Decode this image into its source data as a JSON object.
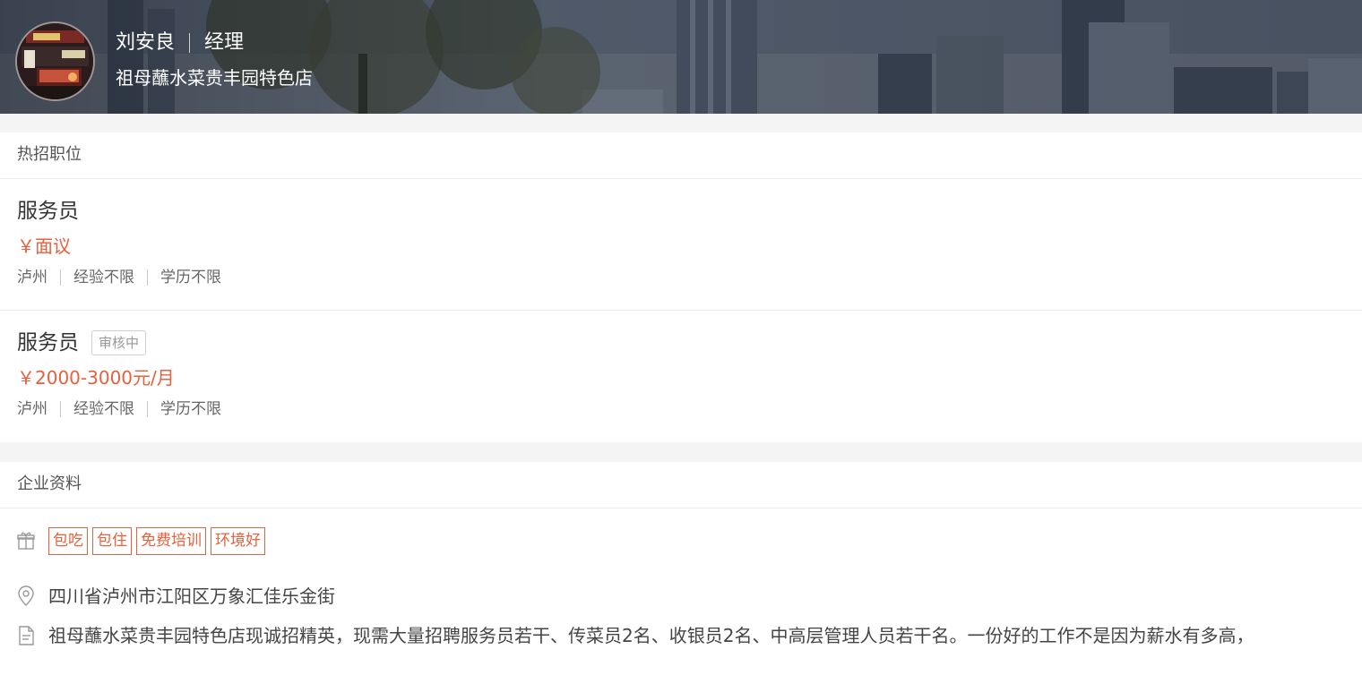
{
  "header": {
    "name": "刘安良",
    "role": "经理",
    "company": "祖母蘸水菜贵丰园特色店",
    "avatar_icon": "restaurant-storefront-photo"
  },
  "jobs_section": {
    "title": "热招职位",
    "jobs": [
      {
        "name": "服务员",
        "badge": "",
        "salary": "￥面议",
        "city": "泸州",
        "experience": "经验不限",
        "education": "学历不限"
      },
      {
        "name": "服务员",
        "badge": "审核中",
        "salary": "￥2000-3000元/月",
        "city": "泸州",
        "experience": "经验不限",
        "education": "学历不限"
      }
    ]
  },
  "company_section": {
    "title": "企业资料",
    "benefits_icon": "gift-icon",
    "benefits": [
      "包吃",
      "包住",
      "免费培训",
      "环境好"
    ],
    "address_icon": "location-pin-icon",
    "address": "四川省泸州市江阳区万象汇佳乐金街",
    "description_icon": "document-icon",
    "description": "祖母蘸水菜贵丰园特色店现诚招精英，现需大量招聘服务员若干、传菜员2名、收银员2名、中高层管理人员若干名。一份好的工作不是因为薪水有多高，"
  },
  "colors": {
    "accent": "#e8603c",
    "page_bg": "#f4f4f4",
    "card_bg": "#ffffff",
    "divider": "#ececec"
  }
}
